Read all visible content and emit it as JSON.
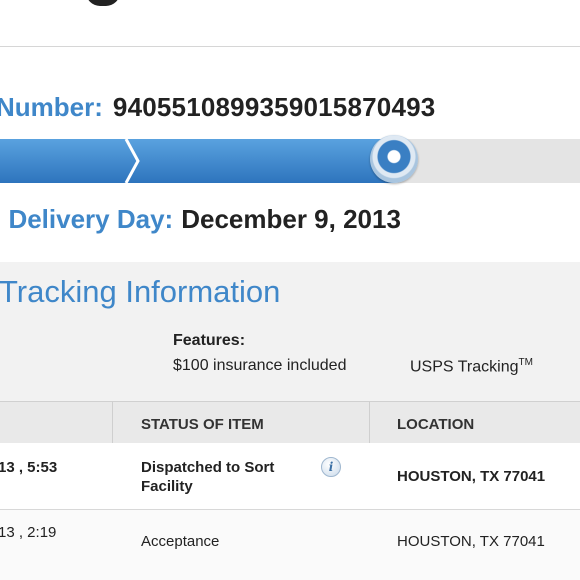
{
  "tracking": {
    "label": "Number:",
    "number": "9405510899359015870493"
  },
  "progress": {
    "completed_fraction": 0.68
  },
  "delivery": {
    "label": "l Delivery Day:",
    "date": "December 9, 2013"
  },
  "tracking_info": {
    "title": "Tracking Information",
    "features_label": "Features:",
    "features": [
      "$100 insurance included",
      "USPS Tracking"
    ],
    "trademark": "TM"
  },
  "table": {
    "headers": [
      "STATUS OF ITEM",
      "LOCATION"
    ],
    "rows": [
      {
        "datetime": "13 , 5:53",
        "status_line1": "Dispatched to Sort",
        "status_line2": "Facility",
        "location": "HOUSTON, TX 77041"
      },
      {
        "datetime": "13 , 2:19",
        "status_line1": "Acceptance",
        "location": "HOUSTON, TX 77041"
      }
    ]
  },
  "colors": {
    "accent": "#3f87c9",
    "progress_fill": "#2e74bd",
    "text": "#222222"
  },
  "icons": {
    "info": "info-icon",
    "progress": "progress-marker-icon"
  }
}
